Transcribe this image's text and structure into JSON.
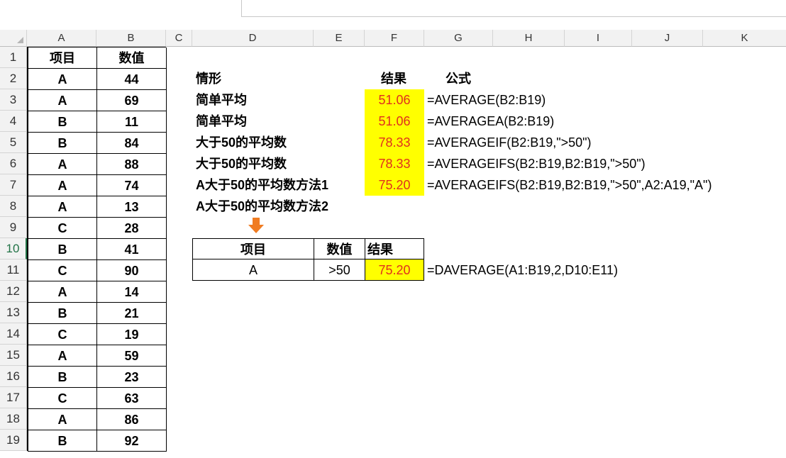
{
  "columns": [
    "A",
    "B",
    "C",
    "D",
    "E",
    "F",
    "G",
    "H",
    "I",
    "J",
    "K"
  ],
  "rows": [
    "1",
    "2",
    "3",
    "4",
    "5",
    "6",
    "7",
    "8",
    "9",
    "10",
    "11",
    "12",
    "13",
    "14",
    "15",
    "16",
    "17",
    "18",
    "19"
  ],
  "selected_row": "10",
  "table1": {
    "header": [
      "项目",
      "数值"
    ],
    "data": [
      [
        "A",
        "44"
      ],
      [
        "A",
        "69"
      ],
      [
        "B",
        "11"
      ],
      [
        "B",
        "84"
      ],
      [
        "A",
        "88"
      ],
      [
        "A",
        "74"
      ],
      [
        "A",
        "13"
      ],
      [
        "C",
        "28"
      ],
      [
        "B",
        "41"
      ],
      [
        "C",
        "90"
      ],
      [
        "A",
        "14"
      ],
      [
        "B",
        "21"
      ],
      [
        "C",
        "19"
      ],
      [
        "A",
        "59"
      ],
      [
        "B",
        "23"
      ],
      [
        "C",
        "63"
      ],
      [
        "A",
        "86"
      ],
      [
        "B",
        "92"
      ]
    ]
  },
  "summary": {
    "header": {
      "situation": "情形",
      "result": "结果",
      "formula": "公式"
    },
    "rows": [
      {
        "situation": "简单平均",
        "result": "51.06",
        "formula": "=AVERAGE(B2:B19)"
      },
      {
        "situation": "简单平均",
        "result": "51.06",
        "formula": "=AVERAGEA(B2:B19)"
      },
      {
        "situation": "大于50的平均数",
        "result": "78.33",
        "formula": "=AVERAGEIF(B2:B19,\">50\")"
      },
      {
        "situation": "大于50的平均数",
        "result": "78.33",
        "formula": "=AVERAGEIFS(B2:B19,B2:B19,\">50\")"
      },
      {
        "situation": "A大于50的平均数方法1",
        "result": "75.20",
        "formula": "=AVERAGEIFS(B2:B19,B2:B19,\">50\",A2:A19,\"A\")"
      },
      {
        "situation": "A大于50的平均数方法2",
        "result": "",
        "formula": ""
      }
    ]
  },
  "criteria_table": {
    "header": [
      "项目",
      "数值",
      "结果"
    ],
    "row": [
      "A",
      ">50",
      "75.20"
    ],
    "formula": "=DAVERAGE(A1:B19,2,D10:E11)"
  },
  "colors": {
    "highlight": "#ffff00",
    "result_text": "#e0301e",
    "arrow": "#f07c22"
  }
}
